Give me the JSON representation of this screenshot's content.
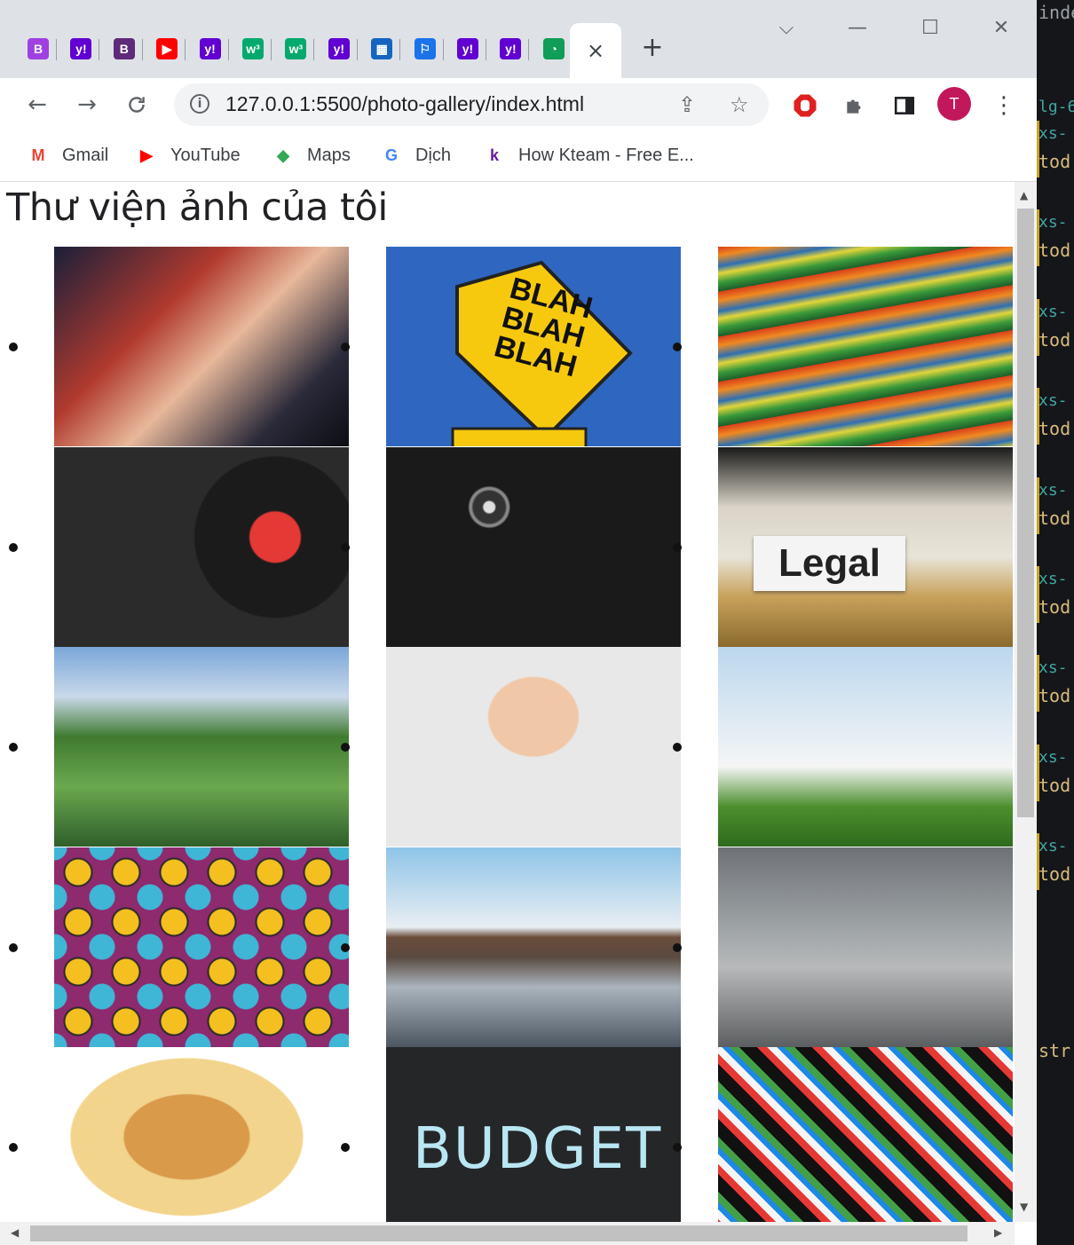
{
  "browser": {
    "tabs": [
      {
        "icon": "blogger-icon",
        "glyph": "B",
        "color": "#a040e0"
      },
      {
        "icon": "yahoo-icon",
        "glyph": "y!",
        "color": "#6001d2"
      },
      {
        "icon": "blogger-dark-icon",
        "glyph": "B",
        "color": "#5f2a7a"
      },
      {
        "icon": "youtube-icon",
        "glyph": "▶",
        "color": "#ff0000"
      },
      {
        "icon": "yahoo-icon",
        "glyph": "y!",
        "color": "#6001d2"
      },
      {
        "icon": "w3-icon",
        "glyph": "w³",
        "color": "#04aa6d"
      },
      {
        "icon": "w3-icon",
        "glyph": "w³",
        "color": "#04aa6d"
      },
      {
        "icon": "yahoo-icon",
        "glyph": "y!",
        "color": "#6001d2"
      },
      {
        "icon": "chart-icon",
        "glyph": "▦",
        "color": "#1565c0"
      },
      {
        "icon": "flag-icon",
        "glyph": "⚐",
        "color": "#1a73e8"
      },
      {
        "icon": "yahoo-icon",
        "glyph": "y!",
        "color": "#6001d2"
      },
      {
        "icon": "yahoo-icon",
        "glyph": "y!",
        "color": "#6001d2"
      },
      {
        "icon": "refresh-circle-icon",
        "glyph": "◔",
        "color": "#0f9d58"
      }
    ],
    "active_tab_close": "×",
    "new_tab": "+",
    "window_controls": {
      "dropdown": "⌵",
      "minimize": "—",
      "maximize": "☐",
      "close": "✕"
    },
    "toolbar": {
      "back": "←",
      "forward": "→",
      "reload": "C",
      "url": "127.0.0.1:5500/photo-gallery/index.html",
      "share": "⇪",
      "bookmark_star": "☆",
      "extensions": [
        "adblock-icon",
        "puzzle-icon",
        "sidepanel-icon"
      ],
      "profile_initial": "T",
      "menu": "⋮"
    },
    "bookmarks": [
      {
        "icon": "gmail-icon",
        "glyph": "M",
        "color": "#ea4335",
        "label": "Gmail"
      },
      {
        "icon": "youtube-icon",
        "glyph": "▶",
        "color": "#ff0000",
        "label": "YouTube"
      },
      {
        "icon": "maps-icon",
        "glyph": "◆",
        "color": "#34a853",
        "label": "Maps"
      },
      {
        "icon": "translate-icon",
        "glyph": "G",
        "color": "#4285f4",
        "label": "Dịch"
      },
      {
        "icon": "kteam-icon",
        "glyph": "k",
        "color": "#6a1b9a",
        "label": "How Kteam - Free E..."
      }
    ]
  },
  "page": {
    "title": "Thư viện ảnh của tôi",
    "photos": [
      {
        "name": "photo-concert-crowd",
        "bg": "linear-gradient(135deg,#1a1f3a 0%,#b03a2e 35%,#e8b89a 55%,#2a2a3a 80%,#0d0d14 100%)"
      },
      {
        "name": "photo-blah-sign",
        "bg": "#2f67c0"
      },
      {
        "name": "photo-colorful-waves",
        "bg": "repeating-linear-gradient(170deg,#d8401c 0px,#f08a20 10px,#2d6fb3 22px,#e2d53a 30px,#3a9a3a 40px,#1d5e2a 50px)"
      },
      {
        "name": "photo-cassettes-vinyl",
        "bg": "radial-gradient(circle at 75% 45%,#e53935 0 28px,#1b1b1b 30px 90px,#2b2b2b 92px),#222"
      },
      {
        "name": "photo-hand-hologram",
        "bg": "radial-gradient(circle at 35% 30%,#e0e0e0 0 6px,#333 8px 18px,#888 20px 22px,#1a1a1a 24px),#151515"
      },
      {
        "name": "photo-legal-folder",
        "bg": "linear-gradient(180deg,#1a1a1a 0%,#d9d4c7 30%,#e8e4d8 55%,#c8a15a 75%,#8b6a2e 100%)"
      },
      {
        "name": "photo-stone-bridge",
        "bg": "linear-gradient(180deg,#7aa7d9 0%,#c9d9ea 25%,#3f7a2f 45%,#6aa84f 70%,#2f5f2a 100%)"
      },
      {
        "name": "photo-boy-camera",
        "bg": "radial-gradient(ellipse at 50% 35%,#f0c8a8 0 50px,#e8e8e8 52px),#e6e6e6"
      },
      {
        "name": "photo-man-field",
        "bg": "linear-gradient(180deg,#bcd7ee 0%,#e6eef4 45%,#f5f5f5 60%,#4c8f2e 80%,#2f6a1d 100%)"
      },
      {
        "name": "photo-spray-cans",
        "bg": "radial-gradient(circle,#f4c020 0 14px,#2a2a2a 15px 16px,transparent 17px) 0 0/54px 56px,radial-gradient(circle,#3fb6d6 0 14px,transparent 15px) 27px 28px/54px 56px,#8e2a6e"
      },
      {
        "name": "photo-jump-bridge",
        "bg": "linear-gradient(180deg,#8ec4e8 0%,#e8eef3 40%,#6b4c3b 45%,#5a4a40 55%,#aab4bd 70%,#4c5661 100%)"
      },
      {
        "name": "photo-books-man",
        "bg": "linear-gradient(180deg,#6e7276 0%,#9ea3a6 40%,#b7b9ba 60%,#5c5f61 100%)"
      },
      {
        "name": "photo-pasta",
        "bg": "radial-gradient(ellipse at 45% 45%,#d99a4a 0 70px,#f2d48c 72px 130px,#ffffff 132px),#1e2a5a"
      },
      {
        "name": "photo-budget-chalkboard",
        "bg": "#242628"
      },
      {
        "name": "photo-graffiti",
        "bg": "repeating-linear-gradient(45deg,#111 0 14px,#e53935 14px 22px,#f5f5f5 22px 30px,#1e88e5 30px 36px,#43a047 36px 44px)"
      }
    ],
    "blah_text": "BLAH\nBLAH\nBLAH",
    "legal_text": "Legal",
    "budget_text": "BUDGET"
  },
  "editor": {
    "top_fragment": "inde",
    "second": "lg-6",
    "repeat_a": "xs-",
    "repeat_b": "tod",
    "last": "str"
  }
}
